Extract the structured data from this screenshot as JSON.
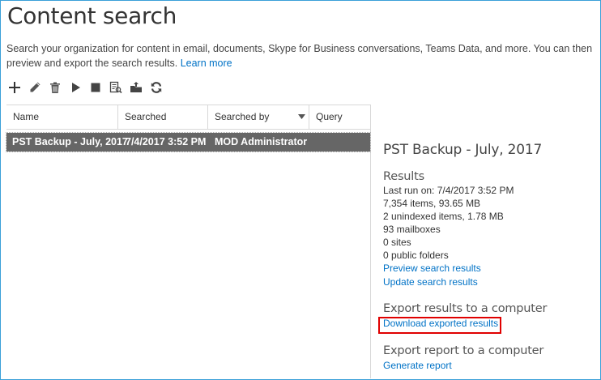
{
  "page": {
    "title": "Content search",
    "description": "Search your organization for content in email, documents, Skype for Business conversations, Teams Data, and more. You can then preview and export the search results.",
    "learn_more": "Learn more"
  },
  "toolbar": {
    "icons": [
      "plus-icon",
      "pencil-icon",
      "trash-icon",
      "play-icon",
      "stop-icon",
      "preview-icon",
      "export-icon",
      "refresh-icon"
    ]
  },
  "grid": {
    "columns": [
      "Name",
      "Searched",
      "Searched by",
      "Query"
    ],
    "rows": [
      {
        "name": "PST Backup - July, 2017",
        "searched": "7/4/2017 3:52 PM",
        "searched_by": "MOD Administrator",
        "query": ""
      }
    ]
  },
  "details": {
    "title": "PST Backup - July, 2017",
    "results_heading": "Results",
    "last_run": "Last run on: 7/4/2017 3:52 PM",
    "items": "7,354 items, 93.65 MB",
    "unindexed": "2 unindexed items, 1.78 MB",
    "mailboxes": "93 mailboxes",
    "sites": "0 sites",
    "public_folders": "0 public folders",
    "preview_link": "Preview search results",
    "update_link": "Update search results",
    "export_results_heading": "Export results to a computer",
    "download_link": "Download exported results",
    "export_report_heading": "Export report to a computer",
    "generate_link": "Generate report"
  },
  "colors": {
    "link": "#0072c6",
    "selected_row": "#666666",
    "highlight_box": "#e00000",
    "frame_border": "#3aa0d8"
  }
}
